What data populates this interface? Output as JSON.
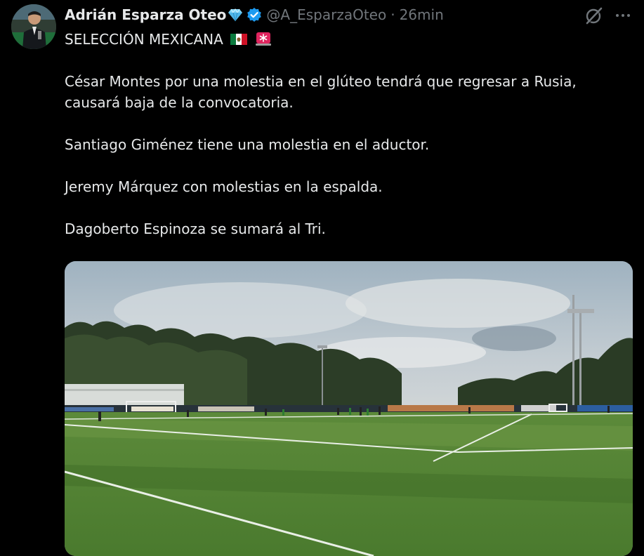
{
  "author": {
    "display_name": "Adrián Esparza Oteo",
    "handle": "@A_EsparzaOteo",
    "separator": "·",
    "time": "26min",
    "avatar_icon": "avatar-photo",
    "badge_icons": [
      "gem-icon",
      "verified-badge-icon"
    ]
  },
  "actions": {
    "grok_icon": "grok-slash-icon",
    "more_icon": "more-dots-icon"
  },
  "tweet": {
    "headline": "SELECCIÓN MEXICANA",
    "headline_emojis": [
      "mexico-flag-icon",
      "siren-icon"
    ],
    "paragraphs": [
      "César Montes por una molestia en el glúteo tendrá que regresar a Rusia, causará baja de la convocatoria.",
      "Santiago Giménez tiene una molestia en el aductor.",
      "Jeremy Márquez con molestias en la espalda.",
      "Dagoberto Espinoza se sumará al Tri."
    ]
  },
  "media": {
    "type": "photo",
    "description_icon": "training-pitch-photo"
  },
  "colors": {
    "background": "#000000",
    "primary_text": "#e7e9ea",
    "secondary_text": "#71767b",
    "verified_blue": "#1d9bf0"
  }
}
